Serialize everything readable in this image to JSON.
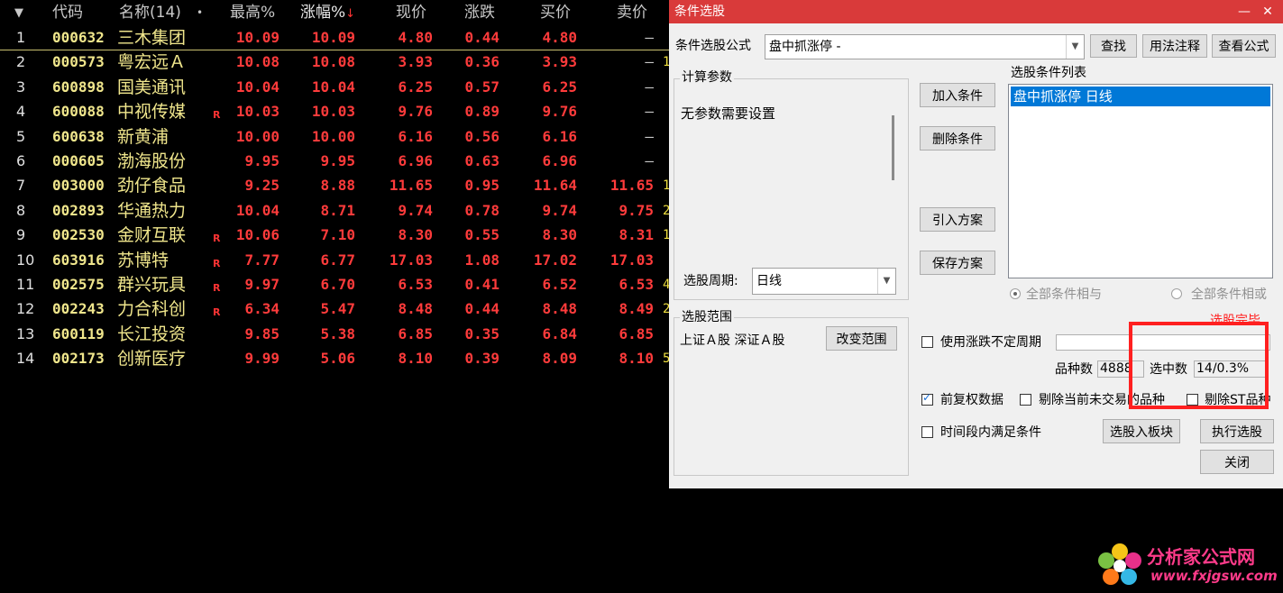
{
  "table": {
    "headers": {
      "menu_arrow": "▼",
      "code": "代码",
      "name": "名称(14)",
      "dot": "•",
      "high": "最高%",
      "pct": "涨幅%",
      "pct_arrow": "↓",
      "price": "现价",
      "chg": "涨跌",
      "buy": "买价",
      "sell": "卖价"
    },
    "rows": [
      {
        "idx": "1",
        "code": "000632",
        "name": "三木集团",
        "flag": "",
        "high": "10.09",
        "pct": "10.09",
        "price": "4.80",
        "chg": "0.44",
        "buy": "4.80",
        "sell": "–",
        "edge": ""
      },
      {
        "idx": "2",
        "code": "000573",
        "name": "粤宏远Ａ",
        "flag": "",
        "high": "10.08",
        "pct": "10.08",
        "price": "3.93",
        "chg": "0.36",
        "buy": "3.93",
        "sell": "–",
        "edge": "1"
      },
      {
        "idx": "3",
        "code": "600898",
        "name": "国美通讯",
        "flag": "",
        "high": "10.04",
        "pct": "10.04",
        "price": "6.25",
        "chg": "0.57",
        "buy": "6.25",
        "sell": "–",
        "edge": ""
      },
      {
        "idx": "4",
        "code": "600088",
        "name": "中视传媒",
        "flag": "R",
        "high": "10.03",
        "pct": "10.03",
        "price": "9.76",
        "chg": "0.89",
        "buy": "9.76",
        "sell": "–",
        "edge": ""
      },
      {
        "idx": "5",
        "code": "600638",
        "name": "新黄浦",
        "flag": "",
        "high": "10.00",
        "pct": "10.00",
        "price": "6.16",
        "chg": "0.56",
        "buy": "6.16",
        "sell": "–",
        "edge": ""
      },
      {
        "idx": "6",
        "code": "000605",
        "name": "渤海股份",
        "flag": "",
        "high": "9.95",
        "pct": "9.95",
        "price": "6.96",
        "chg": "0.63",
        "buy": "6.96",
        "sell": "–",
        "edge": ""
      },
      {
        "idx": "7",
        "code": "003000",
        "name": "劲仔食品",
        "flag": "",
        "high": "9.25",
        "pct": "8.88",
        "price": "11.65",
        "chg": "0.95",
        "buy": "11.64",
        "sell": "11.65",
        "edge": "1"
      },
      {
        "idx": "8",
        "code": "002893",
        "name": "华通热力",
        "flag": "",
        "high": "10.04",
        "pct": "8.71",
        "price": "9.74",
        "chg": "0.78",
        "buy": "9.74",
        "sell": "9.75",
        "edge": "2"
      },
      {
        "idx": "9",
        "code": "002530",
        "name": "金财互联",
        "flag": "R",
        "high": "10.06",
        "pct": "7.10",
        "price": "8.30",
        "chg": "0.55",
        "buy": "8.30",
        "sell": "8.31",
        "edge": "1"
      },
      {
        "idx": "10",
        "code": "603916",
        "name": "苏博特",
        "flag": "R",
        "high": "7.77",
        "pct": "6.77",
        "price": "17.03",
        "chg": "1.08",
        "buy": "17.02",
        "sell": "17.03",
        "edge": ""
      },
      {
        "idx": "11",
        "code": "002575",
        "name": "群兴玩具",
        "flag": "R",
        "high": "9.97",
        "pct": "6.70",
        "price": "6.53",
        "chg": "0.41",
        "buy": "6.52",
        "sell": "6.53",
        "edge": "4"
      },
      {
        "idx": "12",
        "code": "002243",
        "name": "力合科创",
        "flag": "R",
        "high": "6.34",
        "pct": "5.47",
        "price": "8.48",
        "chg": "0.44",
        "buy": "8.48",
        "sell": "8.49",
        "edge": "2"
      },
      {
        "idx": "13",
        "code": "600119",
        "name": "长江投资",
        "flag": "",
        "high": "9.85",
        "pct": "5.38",
        "price": "6.85",
        "chg": "0.35",
        "buy": "6.84",
        "sell": "6.85",
        "edge": ""
      },
      {
        "idx": "14",
        "code": "002173",
        "name": "创新医疗",
        "flag": "",
        "high": "9.99",
        "pct": "5.06",
        "price": "8.10",
        "chg": "0.39",
        "buy": "8.09",
        "sell": "8.10",
        "edge": "5"
      }
    ]
  },
  "dialog": {
    "title": "条件选股",
    "minimize": "—",
    "close": "✕",
    "formula_label": "条件选股公式",
    "formula_value": "盘中抓涨停   -",
    "find_btn": "查找",
    "usage_btn": "用法注释",
    "view_btn": "查看公式",
    "params_group": "计算参数",
    "params_text": "无参数需要设置",
    "period_label": "选股周期:",
    "period_value": "日线",
    "add_btn": "加入条件",
    "del_btn": "删除条件",
    "import_btn": "引入方案",
    "save_btn": "保存方案",
    "cond_list_label": "选股条件列表",
    "cond_list_item": "盘中抓涨停  日线",
    "radio_and": "全部条件相与",
    "radio_or": "全部条件相或",
    "range_group": "选股范围",
    "range_text": "上证Ａ股 深证Ａ股",
    "change_range_btn": "改变范围",
    "red_hint": "选股完毕",
    "use_period_label": "使用涨跌不定周期",
    "count_label": "品种数",
    "count_value": "4888",
    "selected_label": "选中数",
    "selected_value": "14/0.3%",
    "pre_adjust_label": "前复权数据",
    "exclude_untraded_label": "剔除当前未交易的品种",
    "exclude_st_label": "剔除ST品种",
    "time_range_label": "时间段内满足条件",
    "to_block_btn": "选股入板块",
    "execute_btn": "执行选股",
    "close_btn": "关闭",
    "down_arrow": "▼"
  },
  "watermark": {
    "title": "分析家公式网",
    "url": "www.fxjgsw.com"
  },
  "colors": {
    "titlebar": "#d93a3a",
    "stock_code": "#f0e68c",
    "up_red": "#ff3b3b",
    "highlight_box": "#ff2020",
    "selection_blue": "#0078d7"
  }
}
